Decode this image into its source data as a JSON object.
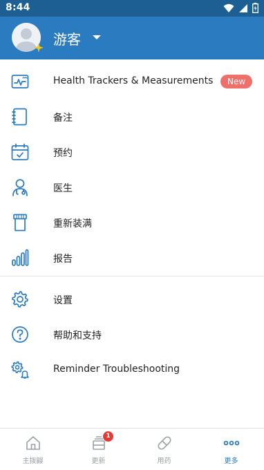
{
  "status": {
    "time": "8:44"
  },
  "header": {
    "profile_name": "游客"
  },
  "menu": {
    "items": [
      {
        "label": "Health Trackers & Measurements",
        "icon": "health-tracker-icon",
        "badge": "New"
      },
      {
        "label": "备注",
        "icon": "notes-icon"
      },
      {
        "label": "预约",
        "icon": "calendar-icon"
      },
      {
        "label": "医生",
        "icon": "doctor-icon"
      },
      {
        "label": "重新装满",
        "icon": "refill-bottle-icon"
      },
      {
        "label": "报告",
        "icon": "bar-chart-icon"
      },
      {
        "label": "设置",
        "icon": "gear-icon"
      },
      {
        "label": "帮助和支持",
        "icon": "help-icon"
      },
      {
        "label": "Reminder Troubleshooting",
        "icon": "reminder-gear-icon"
      }
    ]
  },
  "bottom_nav": {
    "items": [
      {
        "label": "主拨鼹",
        "icon": "home-icon"
      },
      {
        "label": "更新",
        "icon": "updates-icon",
        "badge": "1"
      },
      {
        "label": "用药",
        "icon": "pill-icon"
      },
      {
        "label": "更多",
        "icon": "more-dots-icon",
        "active": true
      }
    ]
  },
  "colors": {
    "header_blue": "#2a7bc0",
    "status_blue": "#1e5f93",
    "icon_blue": "#2a7bc0",
    "badge_red": "#ef6f6a"
  }
}
